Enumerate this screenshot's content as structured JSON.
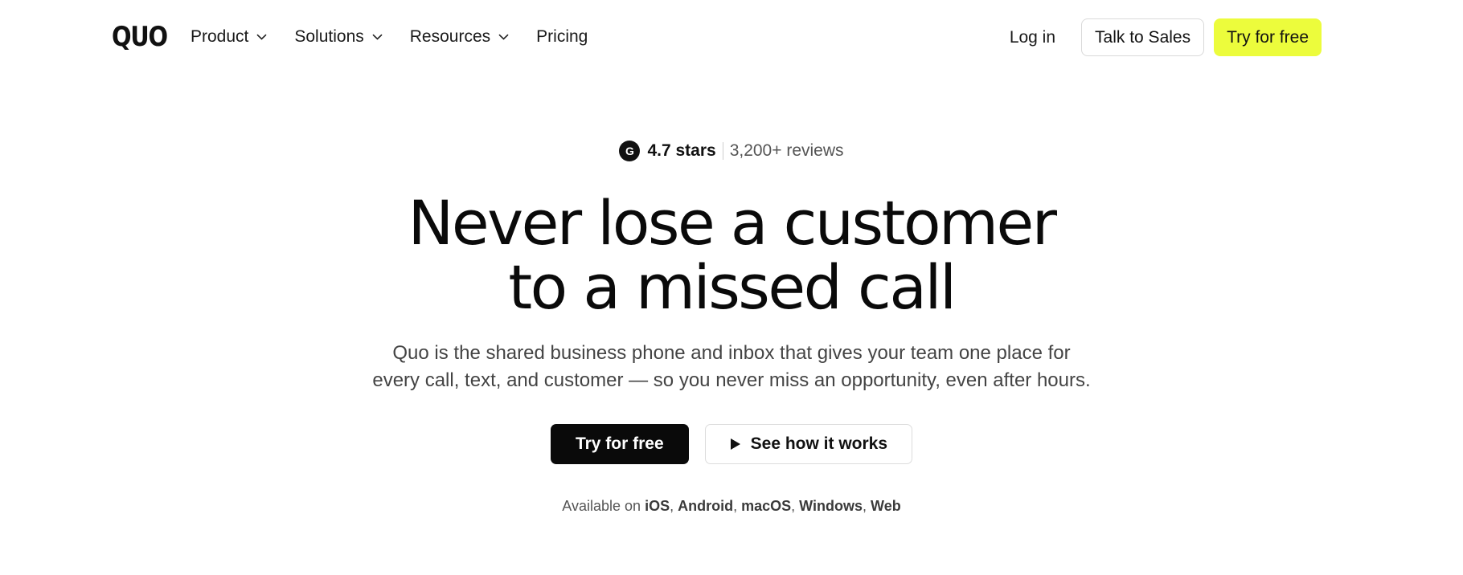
{
  "nav": {
    "logo": "QUO",
    "links": [
      {
        "label": "Product",
        "has_dropdown": true
      },
      {
        "label": "Solutions",
        "has_dropdown": true
      },
      {
        "label": "Resources",
        "has_dropdown": true
      },
      {
        "label": "Pricing",
        "has_dropdown": false
      }
    ],
    "login_label": "Log in",
    "talk_to_sales_label": "Talk to Sales",
    "try_free_label": "Try for free",
    "icons": {
      "dropdown": "chevron-down-icon"
    }
  },
  "hero": {
    "rating": {
      "badge_icon": "g2-logo-icon",
      "stars_text": "4.7 stars",
      "reviews_text": "3,200+ reviews"
    },
    "headline_line1": "Never lose a customer",
    "headline_line2": "to a missed call",
    "subtitle_line1": "Quo is the shared business phone and inbox that gives your team one place for",
    "subtitle_line2": "every call, text, and customer — so you never miss an opportunity, even after hours.",
    "primary_cta": "Try for free",
    "secondary_cta": "See how it works",
    "secondary_cta_icon": "play-icon",
    "platforms_prefix": "Available on",
    "platforms": [
      "iOS",
      "Android",
      "macOS",
      "Windows",
      "Web"
    ]
  },
  "colors": {
    "accent_yellow": "#ecfc3c",
    "primary_dark": "#0a0a0a",
    "text_muted": "#555555"
  }
}
